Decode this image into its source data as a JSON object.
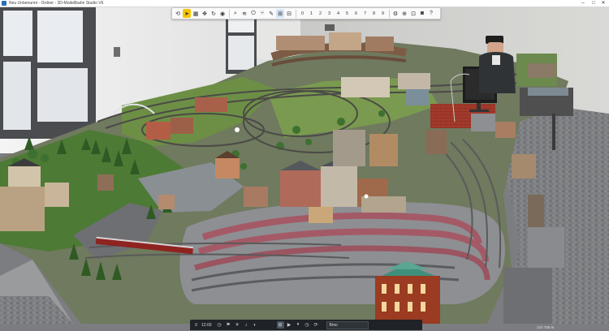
{
  "window": {
    "title": "Neu Unbenannt - Ordner - 3D-Modellbahn Studio V6",
    "controls": [
      "–",
      "□",
      "✕"
    ]
  },
  "toolbar": {
    "left_buttons": [
      {
        "name": "undo-icon",
        "glyph": "⟲",
        "state": ""
      },
      {
        "name": "select-icon",
        "glyph": "➤",
        "state": "sel"
      },
      {
        "name": "layers-icon",
        "glyph": "▦",
        "state": ""
      },
      {
        "name": "move-icon",
        "glyph": "✥",
        "state": ""
      },
      {
        "name": "rotate-icon",
        "glyph": "↻",
        "state": ""
      },
      {
        "name": "camera-icon",
        "glyph": "◉",
        "state": ""
      }
    ],
    "mid_buttons": [
      {
        "name": "zoom-icon",
        "glyph": "⌕",
        "state": ""
      },
      {
        "name": "track-icon",
        "glyph": "≋",
        "state": ""
      },
      {
        "name": "signal-icon",
        "glyph": "⏻",
        "state": ""
      },
      {
        "name": "switch-icon",
        "glyph": "⑂",
        "state": ""
      },
      {
        "name": "edit-icon",
        "glyph": "✎",
        "state": ""
      },
      {
        "name": "view-icon",
        "glyph": "⊞",
        "state": "on"
      },
      {
        "name": "grid-icon",
        "glyph": "⊟",
        "state": ""
      }
    ],
    "number_buttons": [
      "0",
      "1",
      "2",
      "3",
      "4",
      "5",
      "6",
      "7",
      "8",
      "9"
    ],
    "right_buttons": [
      {
        "name": "settings-icon",
        "glyph": "⚙"
      },
      {
        "name": "target-icon",
        "glyph": "⊕"
      },
      {
        "name": "screenshot-icon",
        "glyph": "⊡"
      },
      {
        "name": "record-icon",
        "glyph": "◙"
      },
      {
        "name": "help-icon",
        "glyph": "?"
      }
    ]
  },
  "bottombar": {
    "time": "12:00",
    "mode_label": "Bmo",
    "icons": [
      "⊞",
      "▶",
      "⏸",
      "◷",
      "⟳"
    ]
  },
  "status": {
    "coords": "147.745 m"
  }
}
